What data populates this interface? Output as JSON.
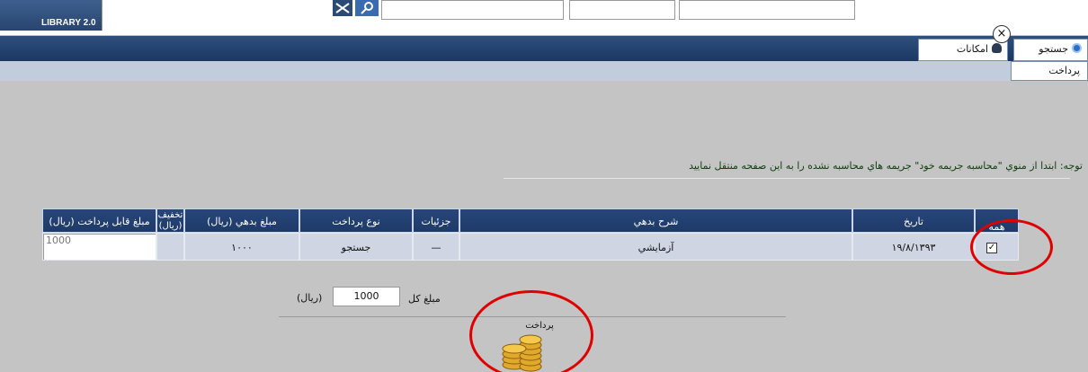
{
  "header": {
    "logo_text": "LIBRARY 2.0",
    "search_value": "",
    "field1_text": "",
    "field2_text": "",
    "user_text": ""
  },
  "nav": {
    "tab_search": "جستجو",
    "tab_facilities": "امكانات",
    "subtab_payment": "پرداخت",
    "close_symbol": "×"
  },
  "notice": "توجه: ابتدا از منوي \"محاسبه جريمه خود\" جريمه هاي محاسبه نشده را به اين صفحه منتقل نماييد",
  "table": {
    "headers": {
      "amount_payable": "مبلغ قابل پرداخت (ريال)",
      "discount": "تخفيف (ريال)",
      "debt_amount": "مبلغ بدهي (ريال)",
      "payment_type": "نوع پرداخت",
      "details": "جزئيات",
      "debt_description": "شرح بدهي",
      "date": "تاريخ",
      "select_all": "همه"
    },
    "rows": [
      {
        "amount_payable": "1000",
        "discount": "",
        "debt_amount": "۱۰۰۰",
        "payment_type": "جستجو",
        "details": "—",
        "debt_description": "آزمايشي",
        "date": "۱۹/۸/۱۳۹۳",
        "checked": "✓"
      }
    ]
  },
  "total": {
    "label": "مبلغ كل",
    "value": "1000",
    "unit": "(ريال)"
  },
  "pay_button_label": "پرداخت",
  "colors": {
    "nav": "#1b3762",
    "header_cell": "#27467a",
    "row": "#cfd5e2",
    "annotation": "#e00000"
  }
}
